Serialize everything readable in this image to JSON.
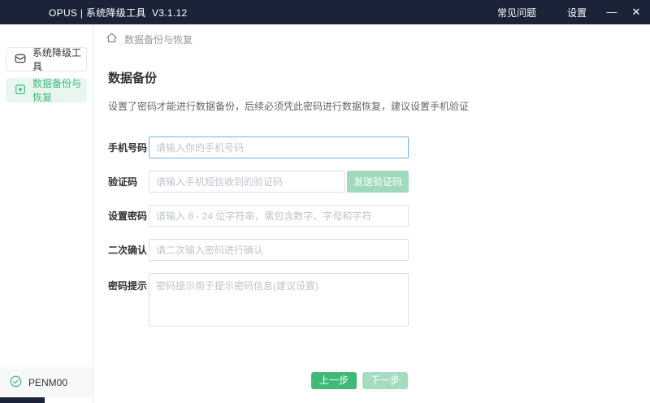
{
  "titlebar": {
    "title": "OPUS | 系统降级工具  V3.1.12",
    "faq_label": "常见问题",
    "settings_label": "设置",
    "minimize_glyph": "—",
    "close_glyph": "✕"
  },
  "sidebar": {
    "items": [
      {
        "label": "系统降级工具",
        "icon": "envelope-icon",
        "active": false
      },
      {
        "label": "数据备份与恢复",
        "icon": "backup-box-icon",
        "active": true
      }
    ],
    "device_label": "PENM00",
    "device_icon": "check-circle-icon"
  },
  "breadcrumb": {
    "home_icon": "home-icon",
    "label": "数据备份与恢复"
  },
  "main": {
    "title": "数据备份",
    "description": "设置了密码才能进行数据备份，后续必须凭此密码进行数据恢复，建议设置手机验证",
    "fields": [
      {
        "label": "手机号码",
        "placeholder": "请输入你的手机号码",
        "value": "",
        "state": "focused"
      },
      {
        "label": "验证码",
        "placeholder": "请输入手机短信收到的验证码",
        "value": "",
        "button_label": "发送验证码",
        "button_state": "disabled"
      },
      {
        "label": "设置密码",
        "placeholder": "请输入 8 - 24 位字符串，需包含数字、字母和字符",
        "value": ""
      },
      {
        "label": "二次确认",
        "placeholder": "请二次输入密码进行确认",
        "value": ""
      },
      {
        "label": "密码提示",
        "placeholder": "密码提示用于提示密码信息(建议设置)",
        "value": "",
        "type": "textarea"
      }
    ],
    "footer_buttons": {
      "prev_label": "上一步",
      "next_label": "下一步",
      "next_disabled": true
    }
  },
  "colors": {
    "titlebar_bg": "#1b2338",
    "accent_green": "#3fb878",
    "accent_green_light": "#a5dcc0",
    "active_item_bg": "#e7f7ee",
    "active_item_text": "#42b884",
    "focused_input_border": "#6db3f2"
  }
}
